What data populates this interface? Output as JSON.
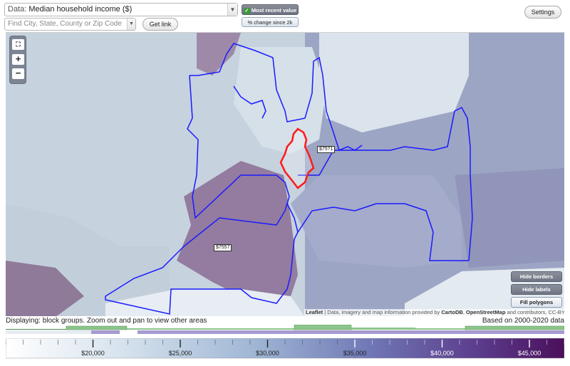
{
  "header": {
    "data_prefix": "Data:",
    "data_value": "Median household income ($)",
    "search_placeholder": "Find City, State, County or Zip Code",
    "get_link": "Get link",
    "settings": "Settings",
    "most_recent": "Most recent value",
    "pct_change": "% change since 2k"
  },
  "map": {
    "zoom_full_icon": "expand-icon",
    "zoom_in": "+",
    "zoom_out": "−",
    "label_1": "$75?1",
    "label_2": "$7557",
    "hide_borders": "Hide borders",
    "hide_labels": "Hide labels",
    "fill_polygons": "Fill polygons",
    "attribution_leaflet": "Leaflet",
    "attribution_rest": " | Data, imagery and map information provided by ",
    "attribution_carto": "CartoDB",
    "attribution_sep": ", ",
    "attribution_osm": "OpenStreetMap",
    "attribution_tail": " and contributors, CC-BY-SA"
  },
  "footer": {
    "displaying": "Displaying: block groups. Zoom out and pan to view other areas",
    "based_on": "Based on 2000-2020 data"
  },
  "legend": {
    "min": 15000,
    "max": 47000,
    "ticks": [
      "$20,000",
      "$25,000",
      "$30,000",
      "$35,000",
      "$40,000",
      "$45,000"
    ],
    "tick_values": [
      20000,
      25000,
      30000,
      35000,
      40000,
      45000
    ],
    "colors": [
      "#ffffff",
      "#d5e3ee",
      "#9bb4d3",
      "#6d78b5",
      "#5a3a8a",
      "#4a0f5a"
    ],
    "accent_green": "#8cc58c"
  }
}
